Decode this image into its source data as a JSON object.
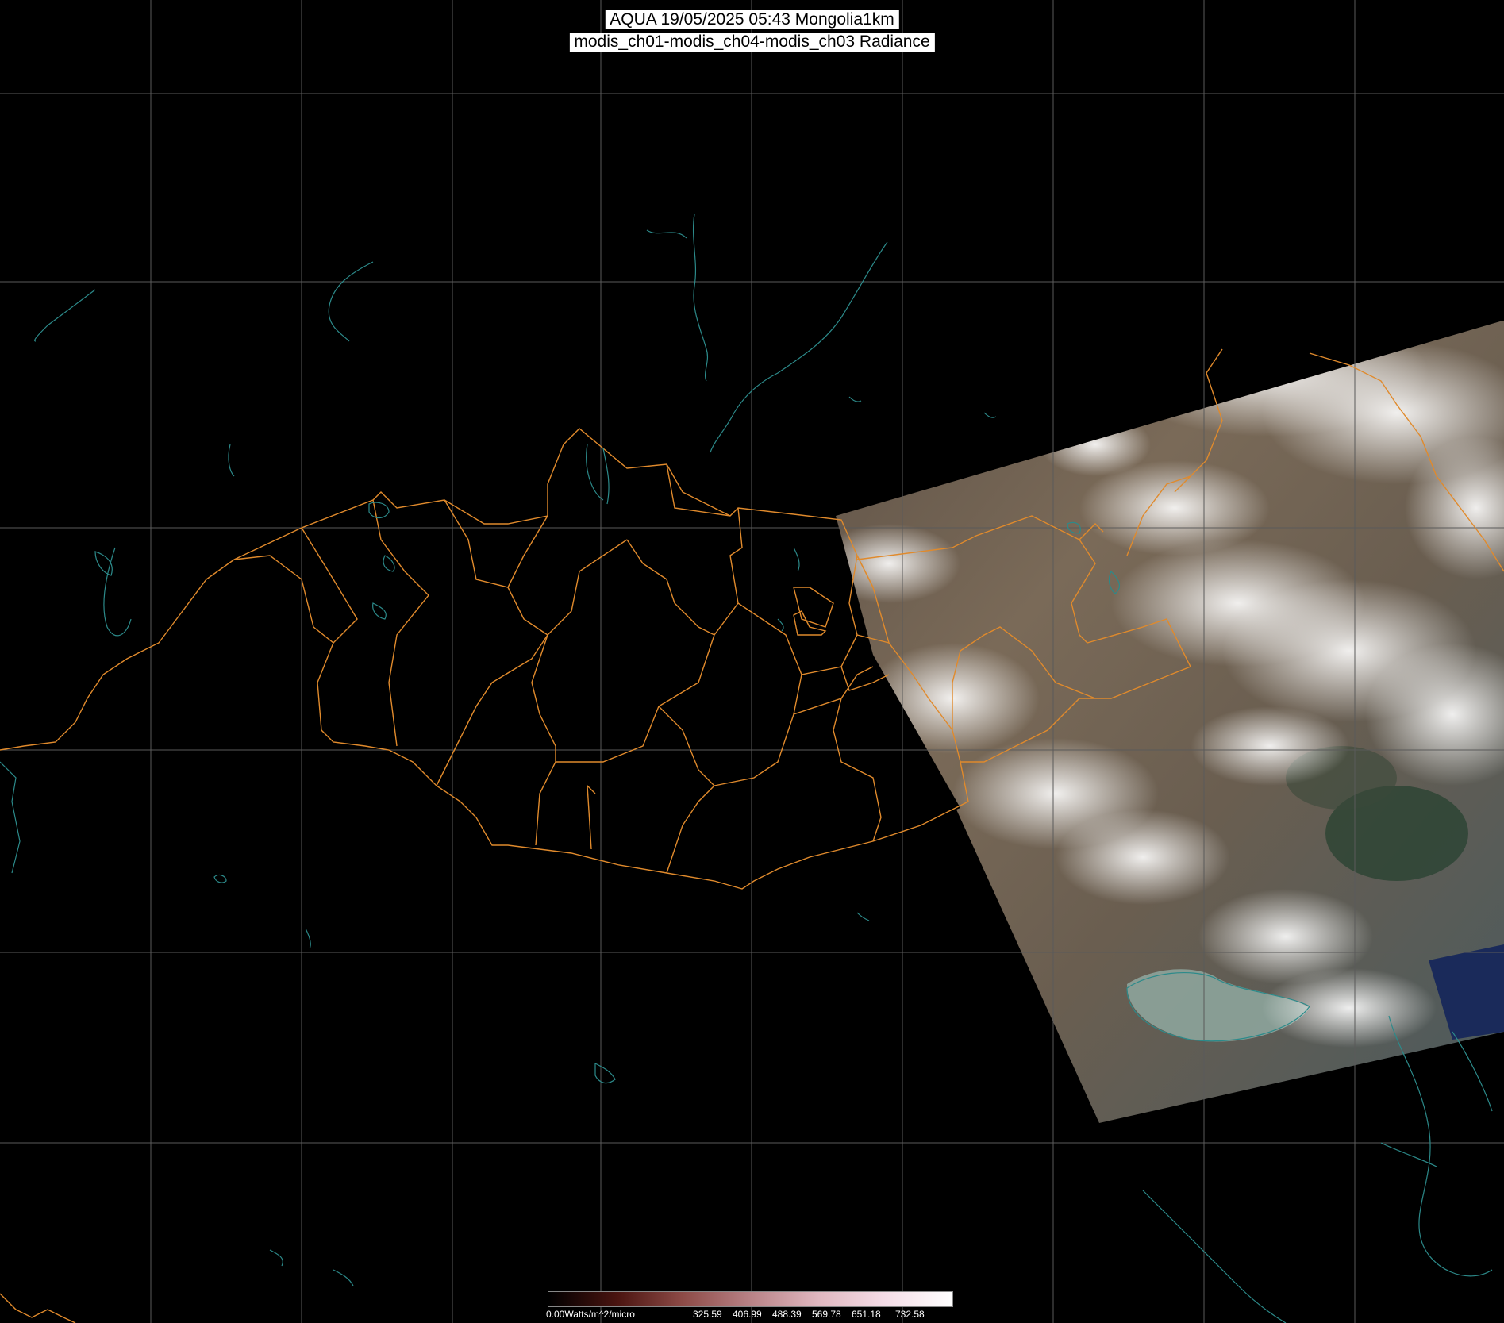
{
  "header": {
    "title_line1": "AQUA 19/05/2025 05:43 Mongolia1km",
    "title_line2": "modis_ch01-modis_ch04-modis_ch03 Radiance"
  },
  "map": {
    "region": "Mongolia",
    "graticule_color": "#5a5a5a",
    "border_color": "#e08a2c",
    "coast_color": "#2c8a8a"
  },
  "legend": {
    "min_label": "0.00Watts/m^2/micro",
    "tick_labels": [
      "325.59",
      "406.99",
      "488.39",
      "569.78",
      "651.18",
      "732.58"
    ],
    "gradient_colors": [
      "#000000",
      "#4a1410",
      "#8c4a46",
      "#b88286",
      "#e0b8c0",
      "#f4dce6",
      "#ffffff"
    ]
  }
}
